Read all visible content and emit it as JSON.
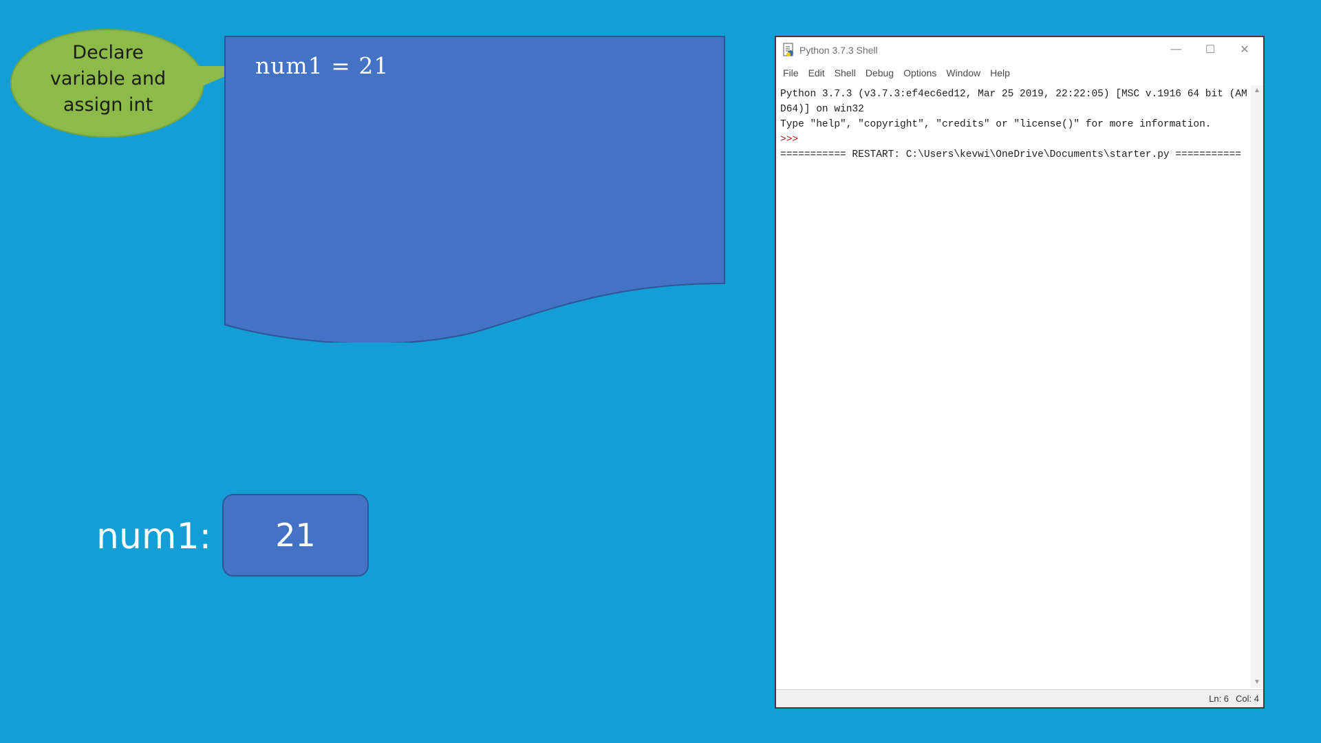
{
  "slide": {
    "callout": "Declare\nvariable and\nassign int",
    "code": "num1 = 21",
    "variable": {
      "name": "num1:",
      "value": "21"
    },
    "colors": {
      "background": "#139fd6",
      "shape_fill": "#4472c4",
      "callout_fill": "#8dbb4a"
    }
  },
  "shell": {
    "title": "Python 3.7.3 Shell",
    "icon": "python-idle-icon",
    "controls": {
      "minimize": "—",
      "maximize": "☐",
      "close": "✕"
    },
    "menu": [
      "File",
      "Edit",
      "Shell",
      "Debug",
      "Options",
      "Window",
      "Help"
    ],
    "console": {
      "line1": "Python 3.7.3 (v3.7.3:ef4ec6ed12, Mar 25 2019, 22:22:05) [MSC v.1916 64 bit (AM",
      "line2": "D64)] on win32",
      "line3": "Type \"help\", \"copyright\", \"credits\" or \"license()\" for more information.",
      "prompt": ">>>",
      "restart": "=========== RESTART: C:\\Users\\kevwi\\OneDrive\\Documents\\starter.py ==========="
    },
    "status": {
      "line": "Ln: 6",
      "col": "Col: 4"
    }
  }
}
